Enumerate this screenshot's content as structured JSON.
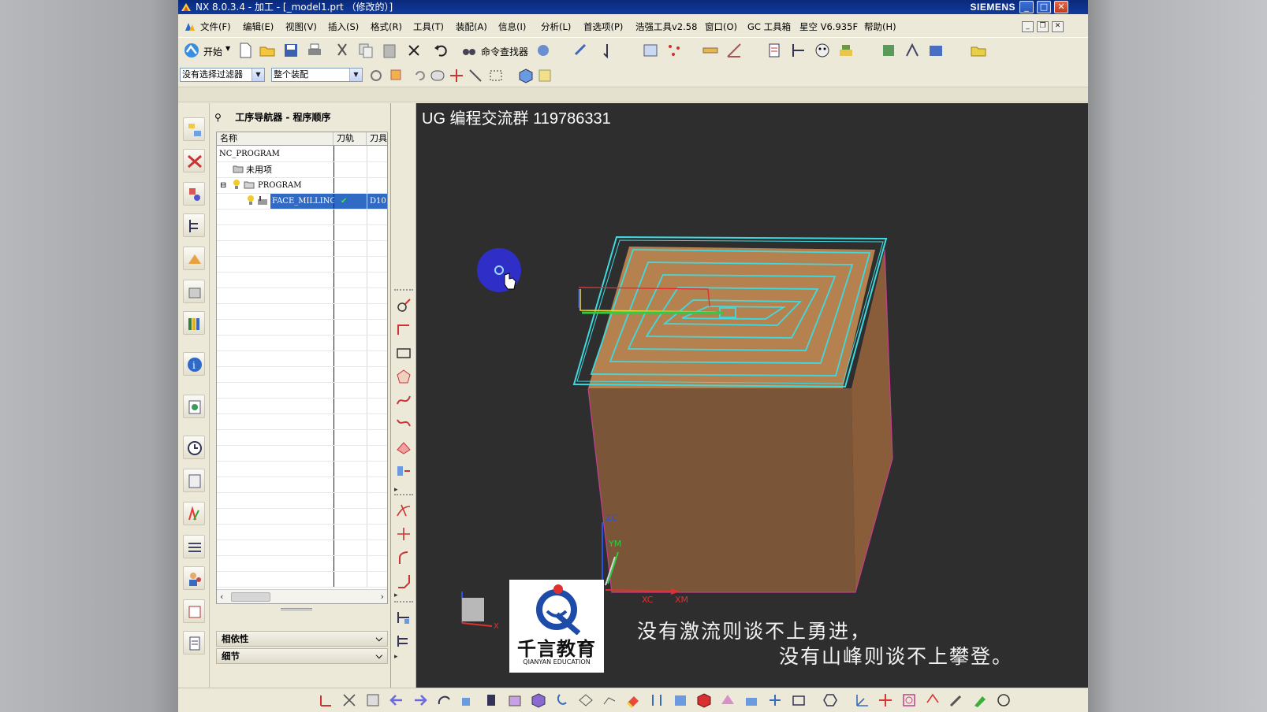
{
  "window": {
    "title": "NX 8.0.3.4 - 加工 - [_model1.prt （修改的）]",
    "brand": "SIEMENS",
    "controls": [
      "minimize",
      "maximize",
      "close"
    ]
  },
  "menu": {
    "items": [
      "文件(F)",
      "编辑(E)",
      "视图(V)",
      "插入(S)",
      "格式(R)",
      "工具(T)",
      "装配(A)",
      "信息(I)",
      "分析(L)",
      "首选项(P)",
      "浩强工具v2.58",
      "窗口(O)",
      "GC 工具箱",
      "星空 V6.935F",
      "帮助(H)"
    ]
  },
  "toolbar": {
    "start_label": "开始",
    "command_finder_label": "命令查找器",
    "filter_value": "没有选择过滤器",
    "scope_value": "整个装配"
  },
  "navigator": {
    "title": "工序导航器 - 程序顺序",
    "columns": [
      "名称",
      "刀轨",
      "刀具"
    ],
    "rows": [
      {
        "name": "NC_PROGRAM",
        "path": "",
        "tool": ""
      },
      {
        "name": "未用项",
        "path": "",
        "tool": ""
      },
      {
        "name": "PROGRAM",
        "path": "",
        "tool": ""
      },
      {
        "name": "FACE_MILLING",
        "path": "✔",
        "tool": "D10"
      }
    ],
    "sections": [
      "相依性",
      "细节"
    ]
  },
  "viewport": {
    "overlay_text": "UG 编程交流群 119786331",
    "axis_labels": {
      "zc": "ZC",
      "ym": "YM",
      "xc": "XC",
      "xm": "XM"
    },
    "triad_label": "X"
  },
  "logo": {
    "name": "千言教育",
    "sub": "QIANYAN EDUCATION"
  },
  "subtitle": {
    "line1": "没有激流则谈不上勇进，",
    "line2": "没有山峰则谈不上攀登。"
  },
  "colors": {
    "accent_blue": "#2f2fc8",
    "toolpath_cyan": "#3fd9e0",
    "stock_orange": "#b07a4a",
    "viewport_bg": "#2e2e2e"
  }
}
